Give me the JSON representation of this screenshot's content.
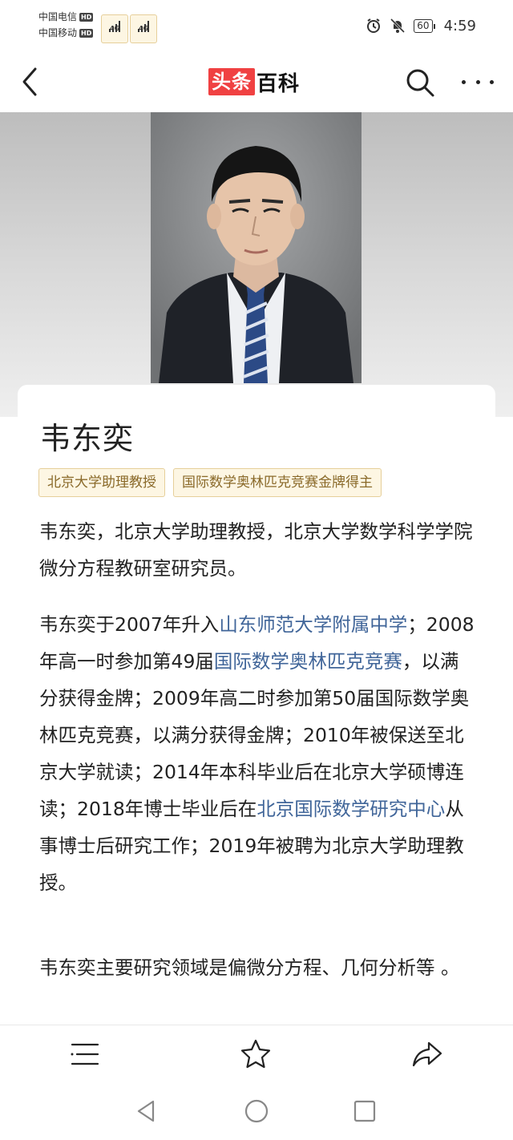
{
  "status_bar": {
    "carrier1": "中国电信",
    "carrier2": "中国移动",
    "hd": "HD",
    "net1": "4G",
    "net2": "4G",
    "battery": "60",
    "time": "4:59"
  },
  "header": {
    "logo_red": "头条",
    "logo_black": "百科"
  },
  "entry": {
    "title": "韦东奕",
    "tags": [
      "北京大学助理教授",
      "国际数学奥林匹克竞赛金牌得主"
    ],
    "p1": "韦东奕，北京大学助理教授，北京大学数学科学学院微分方程教研室研究员。",
    "p2": {
      "s1": "韦东奕于2007年升入",
      "l1": "山东师范大学附属中学",
      "s2": "；2008年高一时参加第49届",
      "l2": "国际数学奥林匹克竞赛",
      "s3": "，以满分获得金牌；2009年高二时参加第50届国际数学奥林匹克竞赛，以满分获得金牌；2010年被保送至北京大学就读；2014年本科毕业后在北京大学硕博连读；2018年博士毕业后在",
      "l3": "北京国际数学研究中心",
      "s4": "从事博士后研究工作；2019年被聘为北京大学助理教授。"
    },
    "p3": "韦东奕主要研究领域是偏微分方程、几何分析等 。"
  },
  "colors": {
    "brand_red": "#f04142",
    "link": "#406599",
    "tag_bg": "#fdf6e3",
    "tag_text": "#8a6a2a"
  },
  "icons": {
    "back": "chevron-left-icon",
    "search": "search-icon",
    "more": "more-dots-icon",
    "menu": "list-menu-icon",
    "favorite": "star-icon",
    "share": "share-icon"
  }
}
